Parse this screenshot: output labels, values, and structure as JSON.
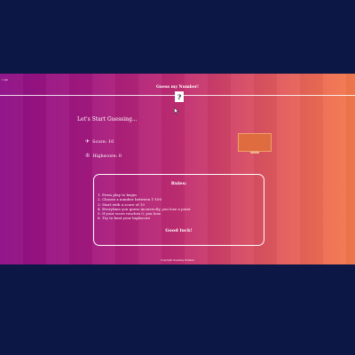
{
  "page": {
    "corner_text": "↑ 2D"
  },
  "header": {
    "title": "Guess my Number!",
    "mystery_value": "?"
  },
  "game": {
    "message": "Let's Start Guessing...",
    "score_icon": "airplane-icon",
    "score_label": "Score: 10",
    "highscore_icon": "trophy-icon",
    "highscore_label": "Highscore: 0",
    "guess_panel_color": "#de6c3f"
  },
  "rules": {
    "title": "Rules:",
    "items": [
      "1. Press play to begin",
      "2. Choose a number between 1-100",
      "3. Start with a score of 10",
      "4. Everytime you guess incorrectly, you lose a point",
      "5. If your score reaches 0, you lose",
      "6. Try to beat your highscore"
    ],
    "footer": "Good luck!"
  },
  "footer": {
    "copyright": "Copyright Guessing Number"
  },
  "colors": {
    "background": "#0d1746",
    "gradient_start": "#8e0f86",
    "gradient_end": "#f57a4c",
    "text": "#ffffff"
  }
}
